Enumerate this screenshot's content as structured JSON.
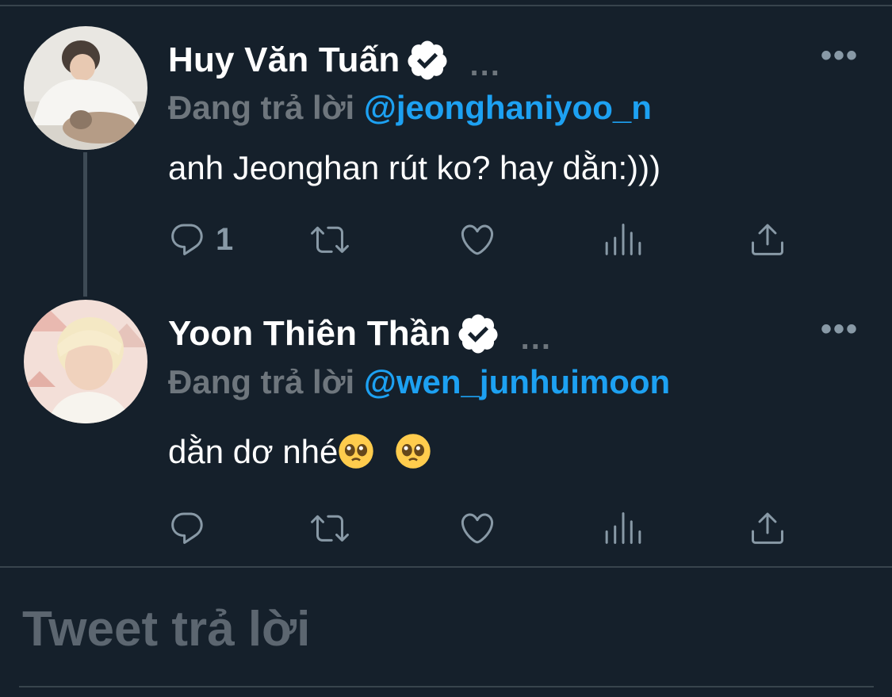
{
  "tweets": [
    {
      "name": "Huy Văn Tuấn",
      "dots": "...",
      "replying_prefix": "Đang trả lời",
      "replying_handle": "@jeonghaniyoo_n",
      "text": "anh Jeonghan rút ko? hay dằn:)))",
      "reply_count": "1",
      "verified": true
    },
    {
      "name": "Yoon Thiên Thần",
      "dots": "...",
      "replying_prefix": "Đang trả lời",
      "replying_handle": "@wen_junhuimoon",
      "text": "dằn dơ nhé",
      "reply_count": "",
      "verified": true
    }
  ],
  "more_label": "•••",
  "compose": {
    "placeholder": "Tweet trả lời"
  },
  "colors": {
    "background": "#15202b",
    "handle": "#1da1f2",
    "muted": "#6e767d",
    "icon": "#8899a6"
  },
  "icons": [
    "reply-icon",
    "retweet-icon",
    "like-icon",
    "analytics-icon",
    "share-icon",
    "verified-badge-icon",
    "pleading-face-emoji"
  ]
}
